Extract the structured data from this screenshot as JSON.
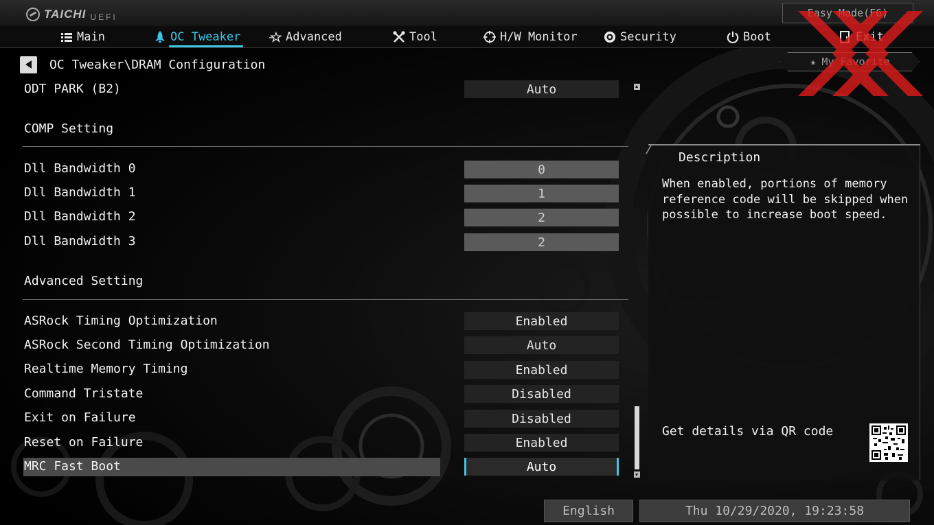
{
  "header": {
    "logo_text": "TAICHI",
    "logo_sub": "UEFI",
    "easy_mode": "Easy Mode(F6)"
  },
  "nav": {
    "items": [
      {
        "label": "Main",
        "icon": "list-icon"
      },
      {
        "label": "OC Tweaker",
        "icon": "rocket-icon"
      },
      {
        "label": "Advanced",
        "icon": "star-icon"
      },
      {
        "label": "Tool",
        "icon": "tools-icon"
      },
      {
        "label": "H/W Monitor",
        "icon": "crosshair-icon"
      },
      {
        "label": "Security",
        "icon": "shield-icon"
      },
      {
        "label": "Boot",
        "icon": "power-icon"
      },
      {
        "label": "Exit",
        "icon": "exit-icon"
      }
    ],
    "active_index": 1
  },
  "breadcrumb": "OC Tweaker\\DRAM Configuration",
  "favorite": {
    "label": "My Favorite"
  },
  "settings": {
    "odt_park": {
      "label": "ODT PARK (B2)",
      "value": "Auto"
    },
    "comp_title": "COMP Setting",
    "dll": [
      {
        "label": "Dll Bandwidth 0",
        "value": "0"
      },
      {
        "label": "Dll Bandwidth 1",
        "value": "1"
      },
      {
        "label": "Dll Bandwidth 2",
        "value": "2"
      },
      {
        "label": "Dll Bandwidth 3",
        "value": "2"
      }
    ],
    "adv_title": "Advanced Setting",
    "advanced": [
      {
        "label": "ASRock Timing Optimization",
        "value": "Enabled"
      },
      {
        "label": "ASRock Second Timing Optimization",
        "value": "Auto"
      },
      {
        "label": "Realtime Memory Timing",
        "value": "Enabled"
      },
      {
        "label": "Command Tristate",
        "value": "Disabled"
      },
      {
        "label": "Exit on Failure",
        "value": "Disabled"
      },
      {
        "label": "Reset on Failure",
        "value": "Enabled"
      },
      {
        "label": "MRC Fast Boot",
        "value": "Auto"
      }
    ]
  },
  "description": {
    "title": "Description",
    "line1": "When enabled, portions of memory",
    "line2": "reference code will be skipped when",
    "line3": "possible to increase boot speed.",
    "qr_text": "Get details via QR code"
  },
  "footer": {
    "language": "English",
    "datetime": "Thu 10/29/2020, 19:23:58"
  },
  "colors": {
    "accent": "#3fc4e6",
    "watermark": "#e01b1b"
  }
}
